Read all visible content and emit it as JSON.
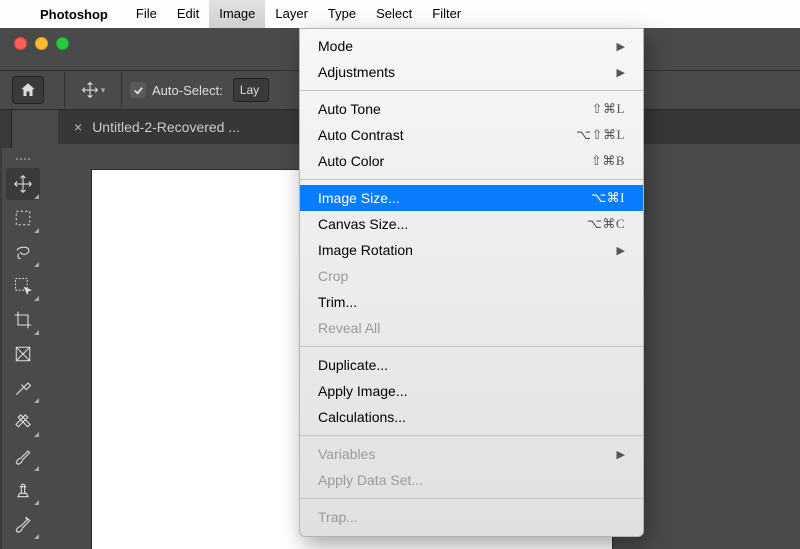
{
  "menubar": {
    "app_name": "Photoshop",
    "items": [
      "File",
      "Edit",
      "Image",
      "Layer",
      "Type",
      "Select",
      "Filter"
    ],
    "active_index": 2
  },
  "options_bar": {
    "auto_select_label": "Auto-Select:",
    "layer_select_label": "Lay"
  },
  "document_tab": {
    "title": "Untitled-2-Recovered ..."
  },
  "image_menu": {
    "sections": [
      [
        {
          "label": "Mode",
          "submenu": true
        },
        {
          "label": "Adjustments",
          "submenu": true
        }
      ],
      [
        {
          "label": "Auto Tone",
          "shortcut": "⇧⌘L"
        },
        {
          "label": "Auto Contrast",
          "shortcut": "⌥⇧⌘L"
        },
        {
          "label": "Auto Color",
          "shortcut": "⇧⌘B"
        }
      ],
      [
        {
          "label": "Image Size...",
          "shortcut": "⌥⌘I",
          "highlighted": true
        },
        {
          "label": "Canvas Size...",
          "shortcut": "⌥⌘C"
        },
        {
          "label": "Image Rotation",
          "submenu": true
        },
        {
          "label": "Crop",
          "disabled": true
        },
        {
          "label": "Trim..."
        },
        {
          "label": "Reveal All",
          "disabled": true
        }
      ],
      [
        {
          "label": "Duplicate..."
        },
        {
          "label": "Apply Image..."
        },
        {
          "label": "Calculations..."
        }
      ],
      [
        {
          "label": "Variables",
          "submenu": true,
          "disabled": true
        },
        {
          "label": "Apply Data Set...",
          "disabled": true
        }
      ],
      [
        {
          "label": "Trap...",
          "disabled": true
        }
      ]
    ]
  },
  "tools": [
    "move-tool",
    "marquee-tool",
    "lasso-tool",
    "quick-select-tool",
    "crop-tool",
    "frame-tool",
    "eyedropper-tool",
    "healing-brush-tool",
    "brush-tool",
    "clone-stamp-tool",
    "history-brush-tool"
  ]
}
